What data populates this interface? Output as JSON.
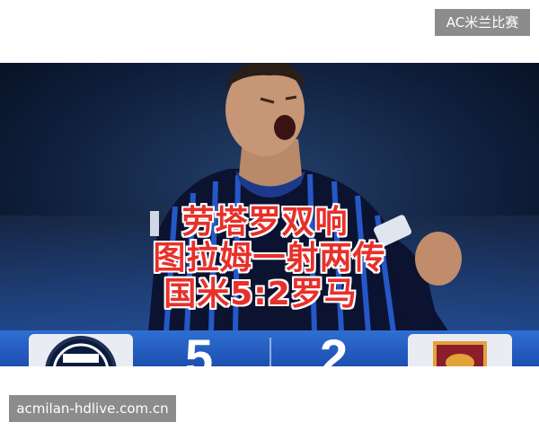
{
  "top_tag": "AC米兰比赛",
  "headline": {
    "line1": "劳塔罗双响",
    "line2": "图拉姆一射两传",
    "line3": "国米5:2罗马"
  },
  "scoreboard": {
    "home_score": "5",
    "away_score": "2",
    "home_team_icon": "inter-crest-icon",
    "away_team_icon": "roma-crest-icon"
  },
  "bottom_tag": "acmilan-hdlive.com.cn",
  "colors": {
    "headline_red": "#e8302a",
    "score_bar_blue": "#2f6fd2",
    "tag_gray": "#8c8c8c"
  }
}
